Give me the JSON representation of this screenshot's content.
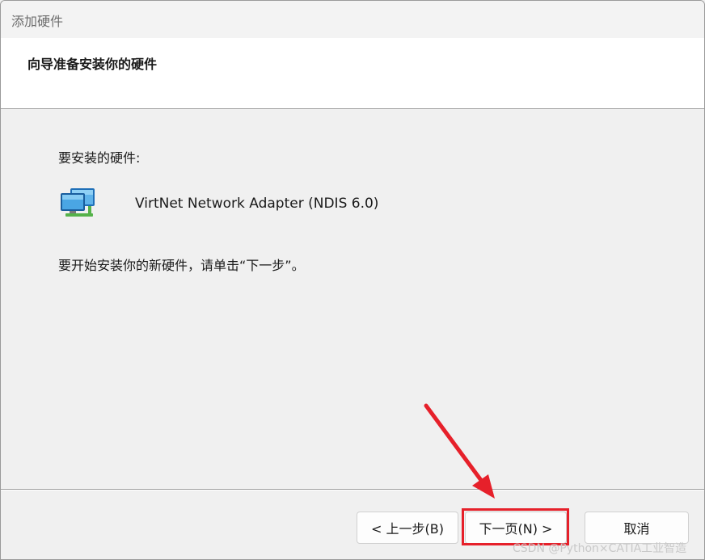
{
  "window": {
    "title": "添加硬件"
  },
  "header": {
    "heading": "向导准备安装你的硬件"
  },
  "content": {
    "hardware_label": "要安装的硬件:",
    "device_name": "VirtNet Network Adapter (NDIS 6.0)",
    "device_icon": "network-adapter-icon",
    "instruction": "要开始安装你的新硬件，请单击“下一步”。"
  },
  "buttons": {
    "back_label": "< 上一步(B)",
    "next_label": "下一页(N) >",
    "cancel_label": "取消"
  },
  "annotation": {
    "highlight_color": "#e6202a"
  },
  "watermark": {
    "text": "CSDN @Python×CATIA工业智造"
  }
}
